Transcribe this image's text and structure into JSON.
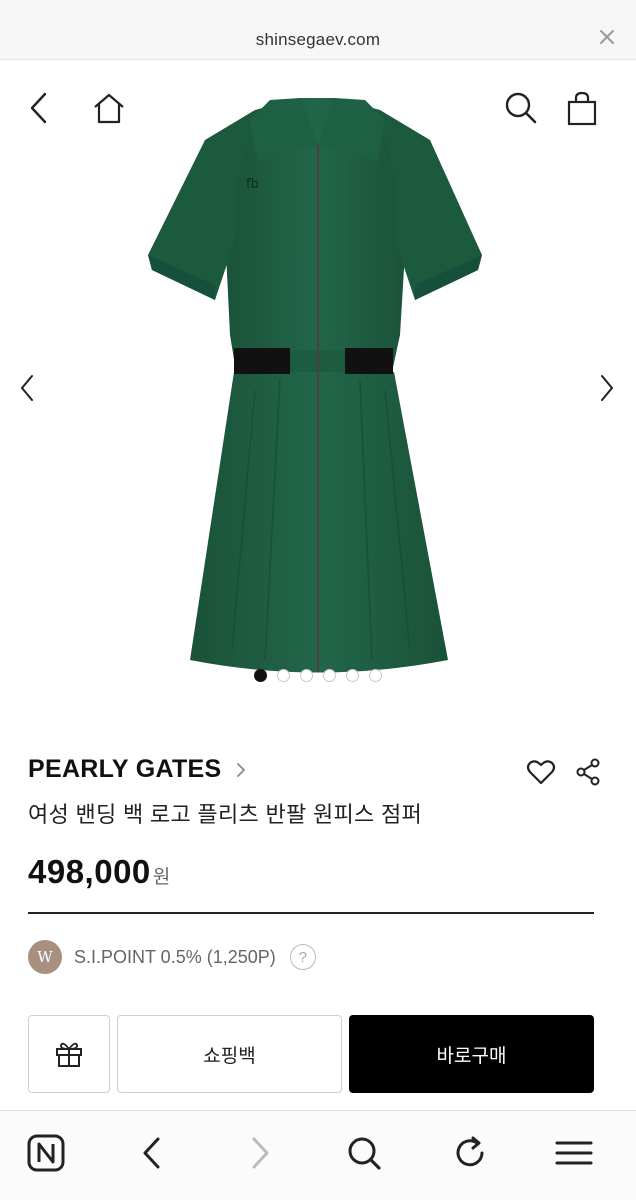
{
  "browser": {
    "domain": "shinsegaev.com",
    "close_icon": "close-icon"
  },
  "nav": {
    "back_icon": "chevron-left-icon",
    "home_icon": "home-icon",
    "search_icon": "search-icon",
    "cart_icon": "shopping-bag-icon"
  },
  "gallery": {
    "image": "green short-sleeve zip-up dress",
    "dot_count": 6,
    "active_dot": 0,
    "prev_icon": "chevron-left-icon",
    "next_icon": "chevron-right-icon"
  },
  "product": {
    "brand": "PEARLY GATES",
    "title": "여성 밴딩 백 로고 플리츠 반팔 원피스 점퍼",
    "price": "498,000",
    "currency": "원"
  },
  "point": {
    "badge": "W",
    "text": "S.I.POINT 0.5% (1,250P)",
    "help": "?"
  },
  "actions": {
    "gift_icon": "gift-icon",
    "bag_label": "쇼핑백",
    "buy_label": "바로구매"
  },
  "toolbar": {
    "items": [
      "n-logo-icon",
      "back-icon",
      "forward-icon",
      "search-icon",
      "refresh-icon",
      "menu-icon"
    ]
  },
  "colors": {
    "dress": "#1f5e3f",
    "buy_button": "#000000",
    "active_dot": "#111111"
  }
}
